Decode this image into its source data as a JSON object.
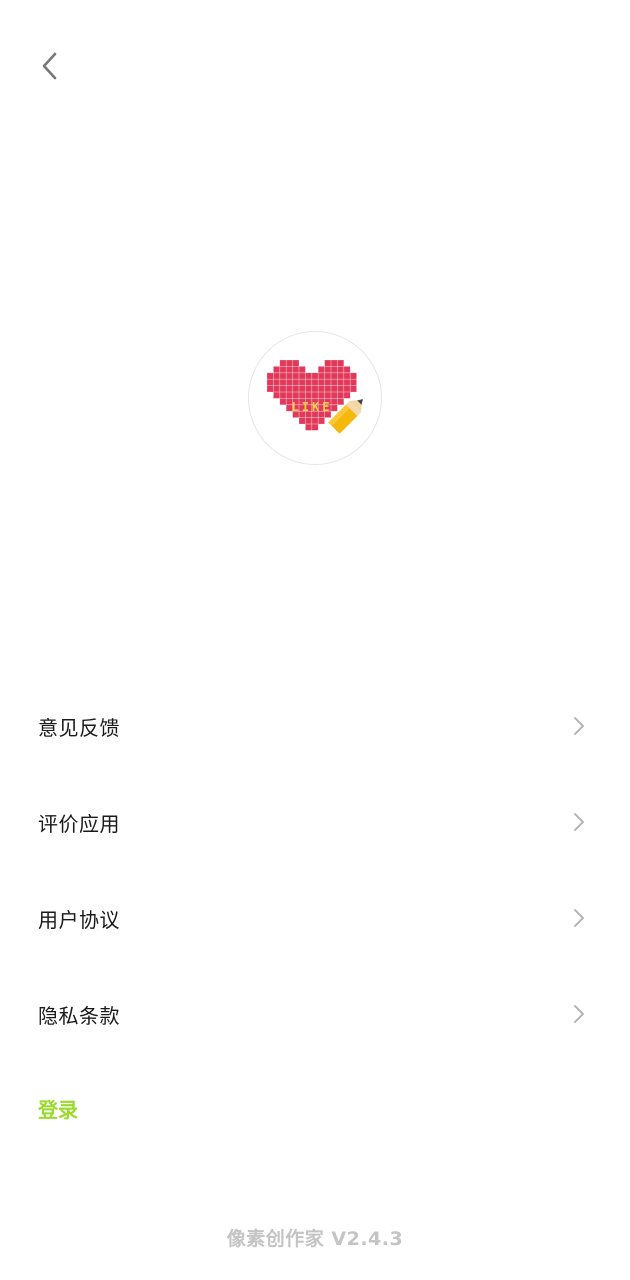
{
  "header": {
    "back_icon": "chevron-left-icon"
  },
  "logo": {
    "heart_text": "LIKE",
    "heart_color": "#e2395a",
    "text_color": "#f4d34a",
    "pencil_color": "#f5b80d"
  },
  "menu": {
    "items": [
      {
        "label": "意见反馈",
        "icon": "chevron-right-icon"
      },
      {
        "label": "评价应用",
        "icon": "chevron-right-icon"
      },
      {
        "label": "用户协议",
        "icon": "chevron-right-icon"
      },
      {
        "label": "隐私条款",
        "icon": "chevron-right-icon"
      }
    ]
  },
  "login": {
    "label": "登录",
    "color": "#9ad92e"
  },
  "footer": {
    "version_text": "像素创作家 V2.4.3"
  }
}
